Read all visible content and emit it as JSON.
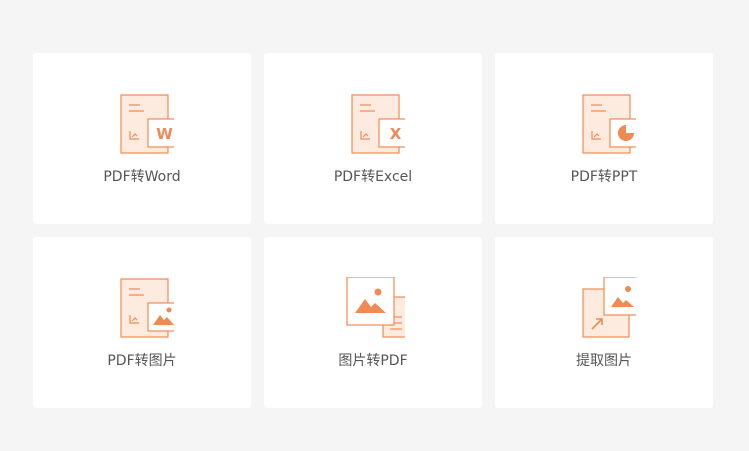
{
  "colors": {
    "accent": "#f08a55",
    "fill_light": "#fdebe0",
    "page_background": "#f5f5f5",
    "card_background": "#ffffff",
    "label_text": "#555555"
  },
  "tools": [
    {
      "label": "PDF转Word",
      "icon": "pdf-to-word-icon"
    },
    {
      "label": "PDF转Excel",
      "icon": "pdf-to-excel-icon"
    },
    {
      "label": "PDF转PPT",
      "icon": "pdf-to-ppt-icon"
    },
    {
      "label": "PDF转图片",
      "icon": "pdf-to-image-icon"
    },
    {
      "label": "图片转PDF",
      "icon": "image-to-pdf-icon"
    },
    {
      "label": "提取图片",
      "icon": "extract-image-icon"
    }
  ]
}
